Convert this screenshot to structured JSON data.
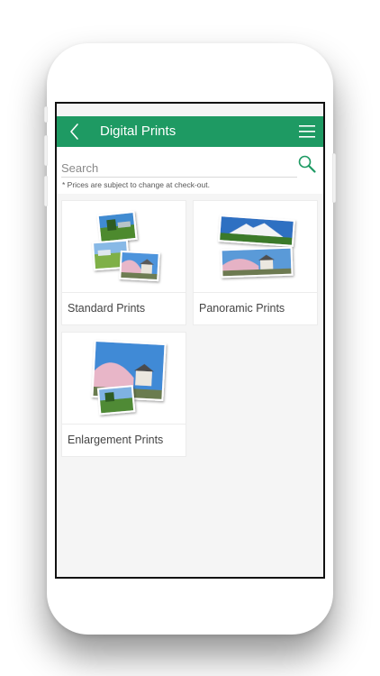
{
  "header": {
    "title": "Digital Prints",
    "back_icon": "chevron-left-icon",
    "menu_icon": "hamburger-menu-icon"
  },
  "search": {
    "placeholder": "Search",
    "value": "",
    "icon": "search-icon",
    "note": "* Prices are subject to change at check-out."
  },
  "products": [
    {
      "label": "Standard Prints"
    },
    {
      "label": "Panoramic Prints"
    },
    {
      "label": "Enlargement Prints"
    }
  ],
  "colors": {
    "accent": "#1e9a63",
    "background": "#f5f5f5"
  }
}
